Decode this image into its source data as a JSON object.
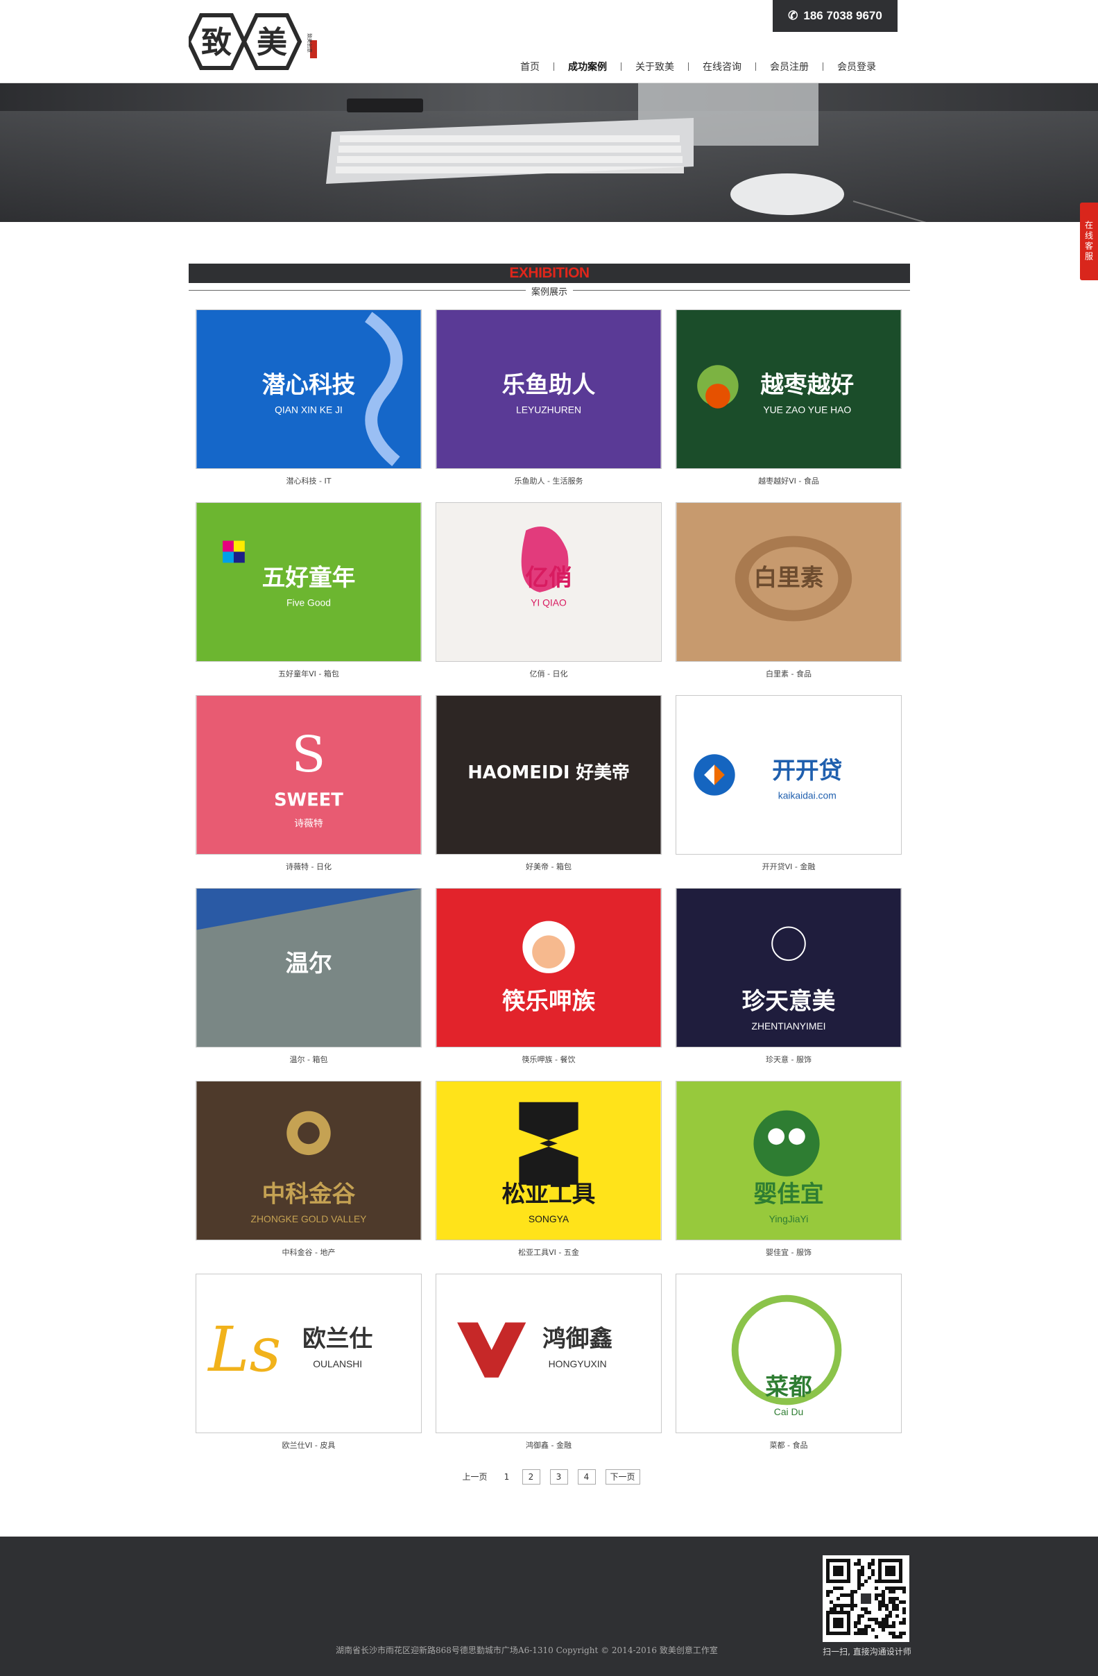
{
  "header": {
    "logo_text": "致美",
    "logo_seal": "致美创意",
    "phone": "186 7038 9670",
    "nav": [
      {
        "label": "首页",
        "active": false
      },
      {
        "label": "成功案例",
        "active": true
      },
      {
        "label": "关于致美",
        "active": false
      },
      {
        "label": "在线咨询",
        "active": false
      },
      {
        "label": "会员注册",
        "active": false
      },
      {
        "label": "会员登录",
        "active": false
      }
    ]
  },
  "side_service": "在线客服",
  "section": {
    "title_en": "EXHIBITION",
    "title_cn": "案例展示"
  },
  "cases": [
    {
      "caption": "潜心科技 - IT",
      "logo": "潜心科技",
      "sub": "QIAN XIN KE JI",
      "bg": "#1567c9"
    },
    {
      "caption": "乐鱼助人 - 生活服务",
      "logo": "乐鱼助人",
      "sub": "LEYUZHUREN",
      "bg": "#5a3a96"
    },
    {
      "caption": "越枣越好VI - 食品",
      "logo": "越枣越好",
      "sub": "YUE ZAO YUE HAO",
      "bg": "#1b4d2a"
    },
    {
      "caption": "五好童年VI - 箱包",
      "logo": "五好童年",
      "sub": "Five Good",
      "bg": "#6cb630"
    },
    {
      "caption": "亿俏 - 日化",
      "logo": "亿俏",
      "sub": "YI QIAO",
      "bg": "#f3f1ee"
    },
    {
      "caption": "白里素 - 食品",
      "logo": "白里素",
      "sub": "",
      "bg": "#c79a6e"
    },
    {
      "caption": "诗薇特 - 日化",
      "logo": "SWEET",
      "sub": "诗薇特",
      "bg": "#e85b72"
    },
    {
      "caption": "好美帝 - 箱包",
      "logo": "HAOMEIDI 好美帝",
      "sub": "",
      "bg": "#2d2624"
    },
    {
      "caption": "开开贷VI - 金融",
      "logo": "开开贷",
      "sub": "kaikaidai.com",
      "bg": "#ffffff"
    },
    {
      "caption": "温尔 - 箱包",
      "logo": "温尔",
      "sub": "",
      "bg": "#6b7a78"
    },
    {
      "caption": "筷乐呷族 - 餐饮",
      "logo": "筷乐呷族",
      "sub": "",
      "bg": "#e2232b"
    },
    {
      "caption": "珍天意 - 服饰",
      "logo": "珍天意美",
      "sub": "ZHENTIANYIMEI",
      "bg": "#1f1d3d"
    },
    {
      "caption": "中科金谷 - 地产",
      "logo": "中科金谷",
      "sub": "ZHONGKE GOLD VALLEY",
      "bg": "#4e3a2b"
    },
    {
      "caption": "松亚工具VI - 五金",
      "logo": "松亚工具",
      "sub": "SONGYA",
      "bg": "#ffe31a"
    },
    {
      "caption": "婴佳宜 - 服饰",
      "logo": "婴佳宜",
      "sub": "YingJiaYi",
      "bg": "#97c93c"
    },
    {
      "caption": "欧兰仕VI - 皮具",
      "logo": "欧兰仕",
      "sub": "OULANSHI",
      "bg": "#ffffff"
    },
    {
      "caption": "鸿御鑫 - 金融",
      "logo": "鸿御鑫",
      "sub": "HONGYUXIN",
      "bg": "#ffffff"
    },
    {
      "caption": "菜都 - 食品",
      "logo": "菜都",
      "sub": "Cai Du",
      "bg": "#ffffff"
    }
  ],
  "pager": {
    "prev": "上一页",
    "pages": [
      "1",
      "2",
      "3",
      "4"
    ],
    "current": "1",
    "next": "下一页"
  },
  "footer": {
    "text": "湖南省长沙市雨花区迎新路868号德思勤城市广场A6-1310  Copyright  ©  2014-2016  致美创意工作室",
    "qr_caption": "扫一扫, 直接沟通设计师"
  }
}
